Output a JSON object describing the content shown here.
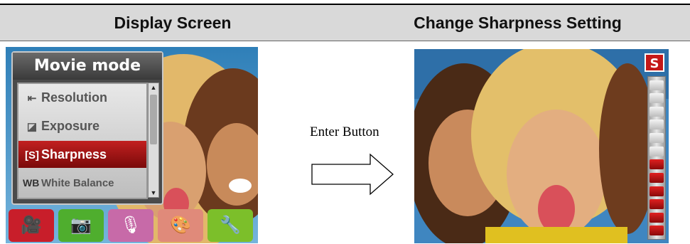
{
  "header": {
    "left_title": "Display Screen",
    "right_title": "Change Sharpness Setting"
  },
  "menu": {
    "title": "Movie mode",
    "items": [
      {
        "icon": "resolution-icon",
        "glyph": "⇤",
        "label": "Resolution",
        "selected": false
      },
      {
        "icon": "exposure-icon",
        "glyph": "◪",
        "label": "Exposure",
        "selected": false
      },
      {
        "icon": "sharpness-icon",
        "glyph": "[S]",
        "label": "Sharpness",
        "selected": true
      },
      {
        "icon": "white-balance-icon",
        "glyph": "WB",
        "label": "White Balance",
        "selected": false
      }
    ]
  },
  "mode_bar": [
    {
      "name": "movie-mode-icon",
      "glyph": "🎥",
      "color": "#c81e2a"
    },
    {
      "name": "camera-mode-icon",
      "glyph": "📷",
      "color": "#4fae2e"
    },
    {
      "name": "voice-mode-icon",
      "glyph": "🎙",
      "color": "#c76aa8"
    },
    {
      "name": "playback-effects-icon",
      "glyph": "🎨",
      "color": "#e08a7a"
    },
    {
      "name": "setup-mode-icon",
      "glyph": "🔧",
      "color": "#7cbf2a"
    }
  ],
  "arrow": {
    "label": "Enter Button"
  },
  "sharpness": {
    "badge": "S",
    "level_fraction": 0.5
  }
}
